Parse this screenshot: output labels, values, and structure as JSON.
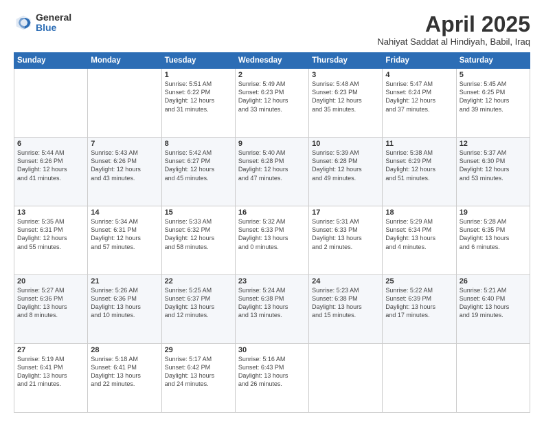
{
  "logo": {
    "general": "General",
    "blue": "Blue"
  },
  "header": {
    "month_year": "April 2025",
    "location": "Nahiyat Saddat al Hindiyah, Babil, Iraq"
  },
  "days_of_week": [
    "Sunday",
    "Monday",
    "Tuesday",
    "Wednesday",
    "Thursday",
    "Friday",
    "Saturday"
  ],
  "weeks": [
    [
      {
        "day": "",
        "info": ""
      },
      {
        "day": "",
        "info": ""
      },
      {
        "day": "1",
        "info": "Sunrise: 5:51 AM\nSunset: 6:22 PM\nDaylight: 12 hours\nand 31 minutes."
      },
      {
        "day": "2",
        "info": "Sunrise: 5:49 AM\nSunset: 6:23 PM\nDaylight: 12 hours\nand 33 minutes."
      },
      {
        "day": "3",
        "info": "Sunrise: 5:48 AM\nSunset: 6:23 PM\nDaylight: 12 hours\nand 35 minutes."
      },
      {
        "day": "4",
        "info": "Sunrise: 5:47 AM\nSunset: 6:24 PM\nDaylight: 12 hours\nand 37 minutes."
      },
      {
        "day": "5",
        "info": "Sunrise: 5:45 AM\nSunset: 6:25 PM\nDaylight: 12 hours\nand 39 minutes."
      }
    ],
    [
      {
        "day": "6",
        "info": "Sunrise: 5:44 AM\nSunset: 6:26 PM\nDaylight: 12 hours\nand 41 minutes."
      },
      {
        "day": "7",
        "info": "Sunrise: 5:43 AM\nSunset: 6:26 PM\nDaylight: 12 hours\nand 43 minutes."
      },
      {
        "day": "8",
        "info": "Sunrise: 5:42 AM\nSunset: 6:27 PM\nDaylight: 12 hours\nand 45 minutes."
      },
      {
        "day": "9",
        "info": "Sunrise: 5:40 AM\nSunset: 6:28 PM\nDaylight: 12 hours\nand 47 minutes."
      },
      {
        "day": "10",
        "info": "Sunrise: 5:39 AM\nSunset: 6:28 PM\nDaylight: 12 hours\nand 49 minutes."
      },
      {
        "day": "11",
        "info": "Sunrise: 5:38 AM\nSunset: 6:29 PM\nDaylight: 12 hours\nand 51 minutes."
      },
      {
        "day": "12",
        "info": "Sunrise: 5:37 AM\nSunset: 6:30 PM\nDaylight: 12 hours\nand 53 minutes."
      }
    ],
    [
      {
        "day": "13",
        "info": "Sunrise: 5:35 AM\nSunset: 6:31 PM\nDaylight: 12 hours\nand 55 minutes."
      },
      {
        "day": "14",
        "info": "Sunrise: 5:34 AM\nSunset: 6:31 PM\nDaylight: 12 hours\nand 57 minutes."
      },
      {
        "day": "15",
        "info": "Sunrise: 5:33 AM\nSunset: 6:32 PM\nDaylight: 12 hours\nand 58 minutes."
      },
      {
        "day": "16",
        "info": "Sunrise: 5:32 AM\nSunset: 6:33 PM\nDaylight: 13 hours\nand 0 minutes."
      },
      {
        "day": "17",
        "info": "Sunrise: 5:31 AM\nSunset: 6:33 PM\nDaylight: 13 hours\nand 2 minutes."
      },
      {
        "day": "18",
        "info": "Sunrise: 5:29 AM\nSunset: 6:34 PM\nDaylight: 13 hours\nand 4 minutes."
      },
      {
        "day": "19",
        "info": "Sunrise: 5:28 AM\nSunset: 6:35 PM\nDaylight: 13 hours\nand 6 minutes."
      }
    ],
    [
      {
        "day": "20",
        "info": "Sunrise: 5:27 AM\nSunset: 6:36 PM\nDaylight: 13 hours\nand 8 minutes."
      },
      {
        "day": "21",
        "info": "Sunrise: 5:26 AM\nSunset: 6:36 PM\nDaylight: 13 hours\nand 10 minutes."
      },
      {
        "day": "22",
        "info": "Sunrise: 5:25 AM\nSunset: 6:37 PM\nDaylight: 13 hours\nand 12 minutes."
      },
      {
        "day": "23",
        "info": "Sunrise: 5:24 AM\nSunset: 6:38 PM\nDaylight: 13 hours\nand 13 minutes."
      },
      {
        "day": "24",
        "info": "Sunrise: 5:23 AM\nSunset: 6:38 PM\nDaylight: 13 hours\nand 15 minutes."
      },
      {
        "day": "25",
        "info": "Sunrise: 5:22 AM\nSunset: 6:39 PM\nDaylight: 13 hours\nand 17 minutes."
      },
      {
        "day": "26",
        "info": "Sunrise: 5:21 AM\nSunset: 6:40 PM\nDaylight: 13 hours\nand 19 minutes."
      }
    ],
    [
      {
        "day": "27",
        "info": "Sunrise: 5:19 AM\nSunset: 6:41 PM\nDaylight: 13 hours\nand 21 minutes."
      },
      {
        "day": "28",
        "info": "Sunrise: 5:18 AM\nSunset: 6:41 PM\nDaylight: 13 hours\nand 22 minutes."
      },
      {
        "day": "29",
        "info": "Sunrise: 5:17 AM\nSunset: 6:42 PM\nDaylight: 13 hours\nand 24 minutes."
      },
      {
        "day": "30",
        "info": "Sunrise: 5:16 AM\nSunset: 6:43 PM\nDaylight: 13 hours\nand 26 minutes."
      },
      {
        "day": "",
        "info": ""
      },
      {
        "day": "",
        "info": ""
      },
      {
        "day": "",
        "info": ""
      }
    ]
  ]
}
